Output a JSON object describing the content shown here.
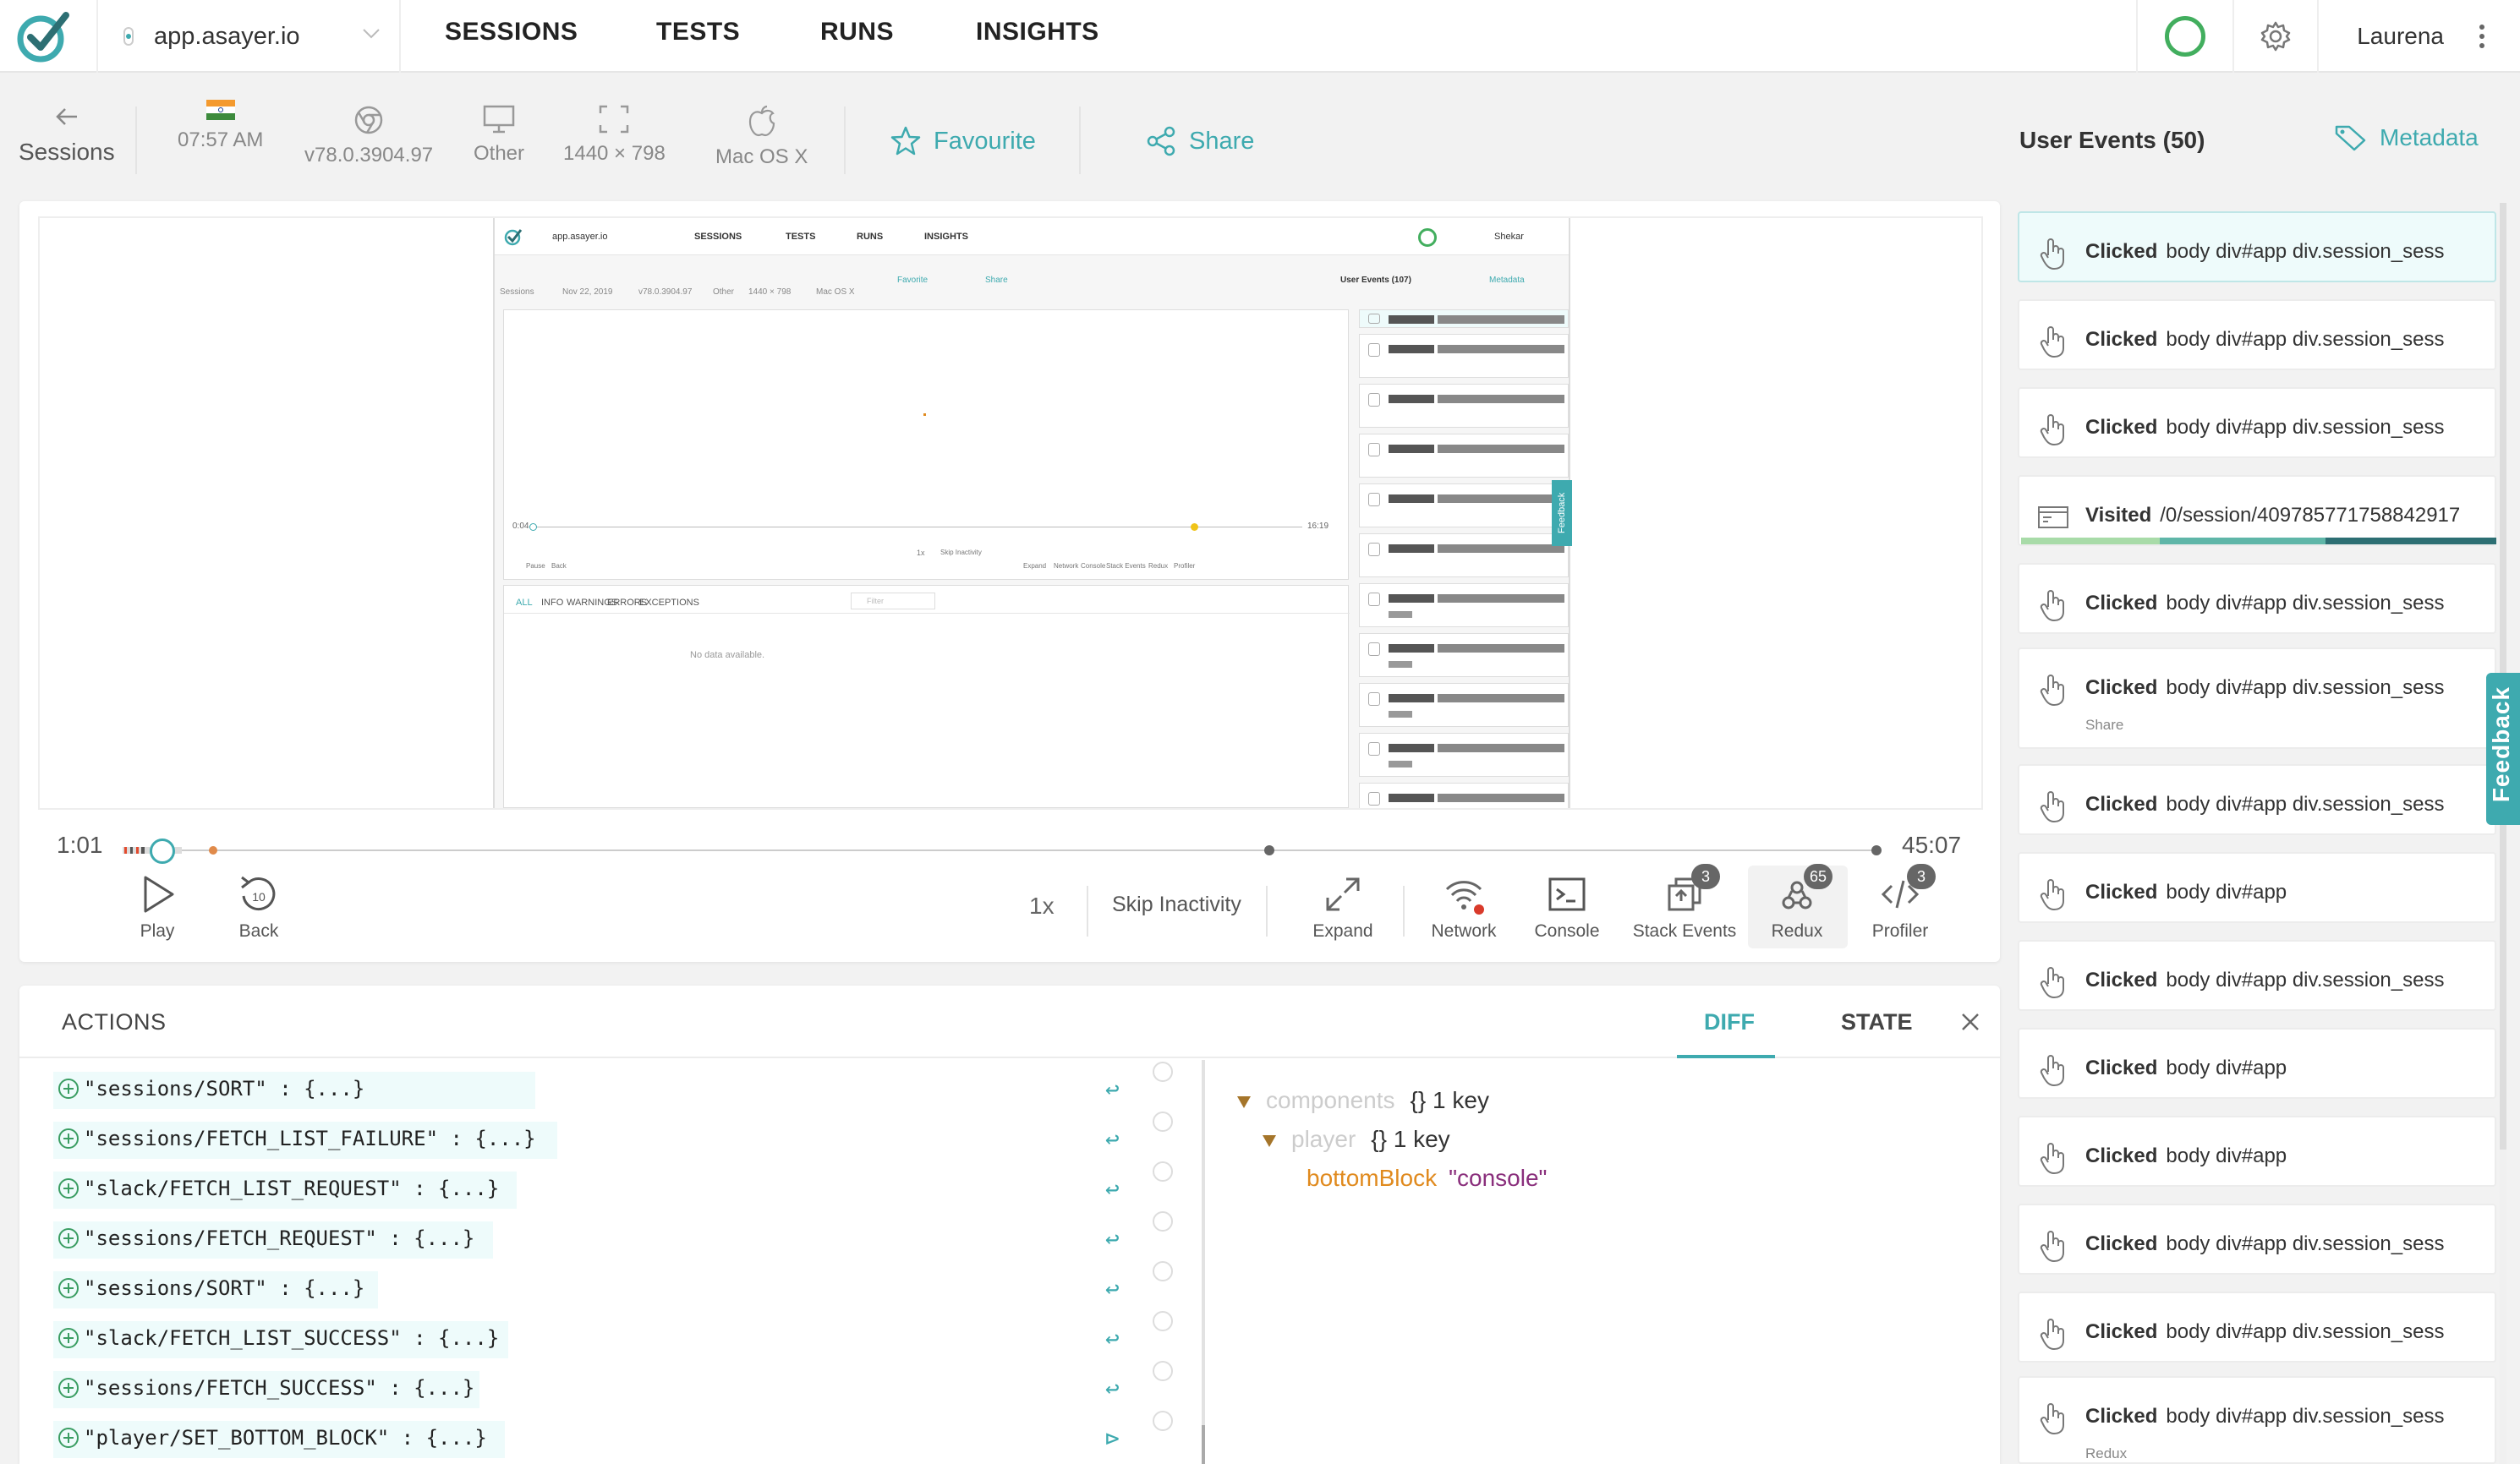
{
  "nav": {
    "site": "app.asayer.io",
    "tabs": [
      "SESSIONS",
      "TESTS",
      "RUNS",
      "INSIGHTS"
    ],
    "user": "Laurena"
  },
  "session_header": {
    "back_label": "Sessions",
    "time": "07:57 AM",
    "browser": "v78.0.3904.97",
    "device": "Other",
    "resolution": "1440 × 798",
    "os": "Mac OS X",
    "favourite_label": "Favourite",
    "share_label": "Share",
    "user_events_title": "User Events (50)",
    "metadata_label": "Metadata"
  },
  "mini_preview": {
    "site": "app.asayer.io",
    "tabs": [
      "SESSIONS",
      "TESTS",
      "RUNS",
      "INSIGHTS"
    ],
    "user": "Shekar",
    "back": "Sessions",
    "date": "Nov 22, 2019",
    "browser": "v78.0.3904.97",
    "device": "Other",
    "resolution": "1440 × 798",
    "os": "Mac OS X",
    "favorite": "Favorite",
    "share": "Share",
    "events_title": "User Events (107)",
    "metadata": "Metadata",
    "time_start": "0:04",
    "time_end": "16:19",
    "controls": [
      "Pause",
      "Back",
      "1x",
      "Skip Inactivity",
      "Expand",
      "Network",
      "Console",
      "Stack Events",
      "Redux",
      "Profiler"
    ],
    "console_tabs": [
      "ALL",
      "INFO",
      "WARNINGS",
      "ERRORS",
      "EXCEPTIONS"
    ],
    "filter_placeholder": "Filter",
    "empty": "No data available.",
    "feedback": "Feedback"
  },
  "player": {
    "time_current": "1:01",
    "time_total": "45:07",
    "progress": 0.023,
    "play_label": "Play",
    "back_label": "Back",
    "back_seconds": "10",
    "speed": "1x",
    "skip_label": "Skip Inactivity",
    "expand_label": "Expand",
    "network_label": "Network",
    "console_label": "Console",
    "stack_label": "Stack Events",
    "stack_count": "3",
    "redux_label": "Redux",
    "redux_count": "65",
    "profiler_label": "Profiler",
    "profiler_count": "3"
  },
  "actions": {
    "title": "ACTIONS",
    "tab_diff": "DIFF",
    "tab_state": "STATE",
    "items": [
      "\"sessions/SORT\" : {...}",
      "\"sessions/FETCH_LIST_FAILURE\" : {...}",
      "\"slack/FETCH_LIST_REQUEST\" : {...}",
      "\"sessions/FETCH_REQUEST\" : {...}",
      "\"sessions/SORT\" : {...}",
      "\"slack/FETCH_LIST_SUCCESS\" : {...}",
      "\"sessions/FETCH_SUCCESS\" : {...}",
      "\"player/SET_BOTTOM_BLOCK\" : {...}"
    ],
    "diff": {
      "k1": "components",
      "v1": "{} 1 key",
      "k2": "player",
      "v2": "{} 1 key",
      "k3": "bottomBlock",
      "v3": "\"console\""
    }
  },
  "events": [
    {
      "type": "Clicked",
      "text": "body div#app div.session_sess",
      "sub": ""
    },
    {
      "type": "Clicked",
      "text": "body div#app div.session_sess",
      "sub": ""
    },
    {
      "type": "Clicked",
      "text": "body div#app div.session_sess",
      "sub": ""
    },
    {
      "type": "Visited",
      "text": "/0/session/409785771758842917",
      "sub": ""
    },
    {
      "type": "Clicked",
      "text": "body div#app div.session_sess",
      "sub": ""
    },
    {
      "type": "Clicked",
      "text": "body div#app div.session_sess",
      "sub": "Share"
    },
    {
      "type": "Clicked",
      "text": "body div#app div.session_sess",
      "sub": ""
    },
    {
      "type": "Clicked",
      "text": "body div#app",
      "sub": ""
    },
    {
      "type": "Clicked",
      "text": "body div#app div.session_sess",
      "sub": ""
    },
    {
      "type": "Clicked",
      "text": "body div#app",
      "sub": ""
    },
    {
      "type": "Clicked",
      "text": "body div#app",
      "sub": ""
    },
    {
      "type": "Clicked",
      "text": "body div#app div.session_sess",
      "sub": ""
    },
    {
      "type": "Clicked",
      "text": "body div#app div.session_sess",
      "sub": ""
    },
    {
      "type": "Clicked",
      "text": "body div#app div.session_sess",
      "sub": "Redux"
    }
  ],
  "feedback_label": "Feedback",
  "colors": {
    "accent": "#3eaaaf",
    "status": "#42ae5e",
    "badge": "#666666"
  }
}
